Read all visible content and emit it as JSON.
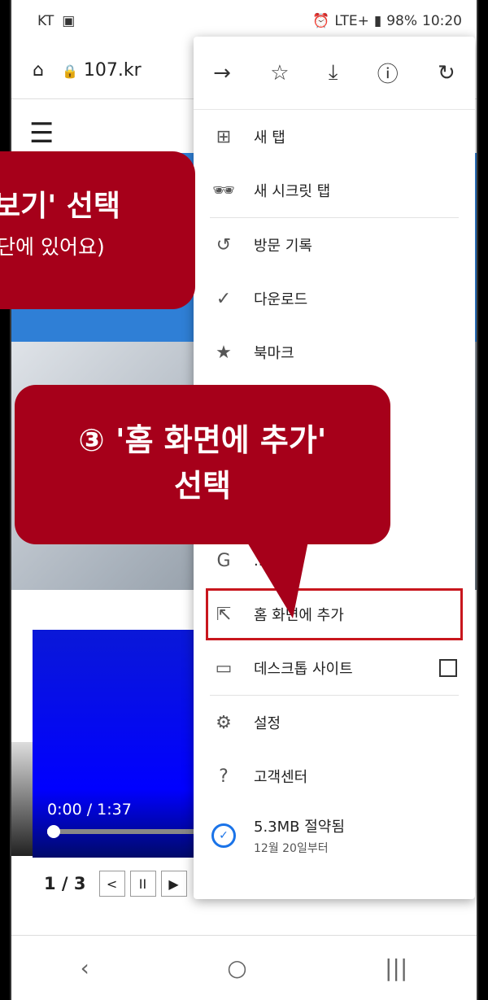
{
  "status": {
    "carrier": "KT",
    "network": "LTE+",
    "battery": "98%",
    "time": "10:20"
  },
  "urlbar": {
    "url": "107.kr"
  },
  "menu": {
    "items": [
      {
        "icon": "new-tab-icon",
        "label": "새 탭"
      },
      {
        "icon": "incognito-icon",
        "label": "새 시크릿 탭"
      },
      {
        "icon": "history-icon",
        "label": "방문 기록"
      },
      {
        "icon": "download-icon",
        "label": "다운로드"
      },
      {
        "icon": "star-icon",
        "label": "북마크"
      },
      {
        "icon": "translate-icon",
        "label": "..."
      },
      {
        "icon": "add-home-icon",
        "label": "홈 화면에 추가"
      },
      {
        "icon": "desktop-icon",
        "label": "데스크톱 사이트"
      },
      {
        "icon": "settings-icon",
        "label": "설정"
      },
      {
        "icon": "help-icon",
        "label": "고객센터"
      }
    ],
    "saved": {
      "amount": "5.3MB 절약됨",
      "since": "12월 20일부터"
    }
  },
  "video": {
    "time": "0:00 / 1:37"
  },
  "pager": {
    "page": "1 / 3"
  },
  "callouts": {
    "step2_line1": "보기' 선택",
    "step2_line2": "단에 있어요)",
    "step3_line1": "③ '홈 화면에 추가'",
    "step3_line2": "선택"
  },
  "colors": {
    "callout": "#a6001a",
    "highlight": "#c8161d",
    "accent": "#1a73e8"
  }
}
